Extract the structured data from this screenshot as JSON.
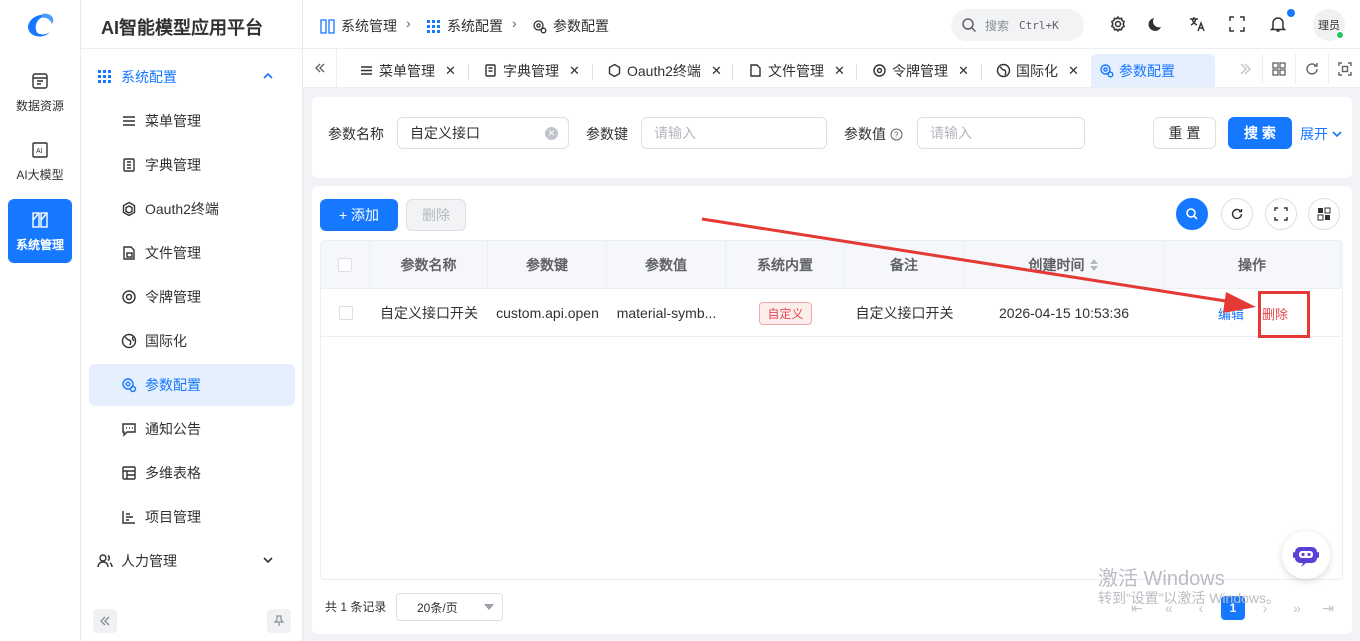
{
  "app": {
    "title": "AI智能模型应用平台"
  },
  "rail": [
    {
      "label": "数据资源",
      "icon": "database-icon",
      "active": false
    },
    {
      "label": "AI大模型",
      "icon": "ai-icon",
      "active": false
    },
    {
      "label": "系统管理",
      "icon": "system-icon",
      "active": true
    }
  ],
  "menu": {
    "group": "系统配置",
    "items": [
      {
        "label": "菜单管理",
        "icon": "list-icon"
      },
      {
        "label": "字典管理",
        "icon": "book-icon"
      },
      {
        "label": "Oauth2终端",
        "icon": "hexagon-icon"
      },
      {
        "label": "文件管理",
        "icon": "file-icon"
      },
      {
        "label": "令牌管理",
        "icon": "token-icon"
      },
      {
        "label": "国际化",
        "icon": "globe-icon"
      },
      {
        "label": "参数配置",
        "icon": "settings-cog-icon",
        "active": true
      },
      {
        "label": "通知公告",
        "icon": "message-icon"
      },
      {
        "label": "多维表格",
        "icon": "table-icon"
      },
      {
        "label": "项目管理",
        "icon": "chart-icon"
      }
    ],
    "collapsed_group": "人力管理"
  },
  "breadcrumb": [
    "系统管理",
    "系统配置",
    "参数配置"
  ],
  "header": {
    "search_label": "搜索",
    "shortcut": "Ctrl+K",
    "avatar": "理员"
  },
  "tabs": [
    {
      "label": "菜单管理"
    },
    {
      "label": "字典管理"
    },
    {
      "label": "Oauth2终端"
    },
    {
      "label": "文件管理"
    },
    {
      "label": "令牌管理"
    },
    {
      "label": "国际化"
    },
    {
      "label": "参数配置",
      "active": true
    }
  ],
  "filters": {
    "name_label": "参数名称",
    "name_value": "自定义接口",
    "key_label": "参数键",
    "key_placeholder": "请输入",
    "value_label": "参数值",
    "value_placeholder": "请输入",
    "reset": "重 置",
    "search": "搜 索",
    "expand": "展开"
  },
  "actions": {
    "add": "+ 添加",
    "delete": "删除"
  },
  "table": {
    "headers": [
      "参数名称",
      "参数键",
      "参数值",
      "系统内置",
      "备注",
      "创建时间",
      "操作"
    ],
    "rows": [
      {
        "name": "自定义接口开关",
        "key": "custom.api.open",
        "value": "material-symb...",
        "builtin": "自定义",
        "remark": "自定义接口开关",
        "created": "2026-04-15 10:53:36",
        "edit": "编辑",
        "delete": "删除"
      }
    ]
  },
  "pagination": {
    "total": "共 1 条记录",
    "page_size": "20条/页",
    "current": "1"
  },
  "watermark": {
    "line1": "激活 Windows",
    "line2": "转到“设置”以激活 Windows。"
  },
  "colors": {
    "accent": "#1677ff",
    "danger": "#e5484d",
    "annotation": "#e53935"
  }
}
